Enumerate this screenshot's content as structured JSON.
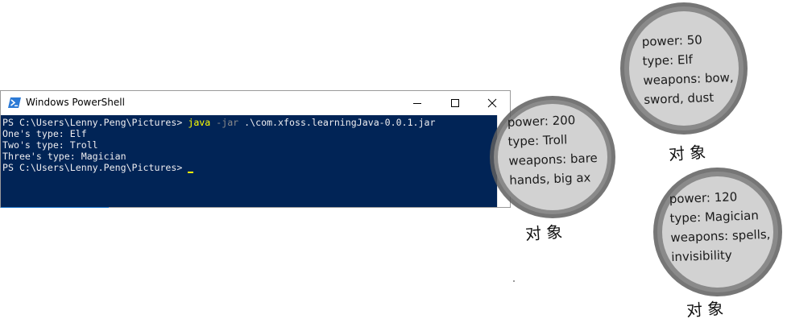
{
  "window": {
    "title": "Windows PowerShell",
    "buttons": {
      "minimize": "minimize",
      "maximize": "maximize",
      "close": "close"
    }
  },
  "console": {
    "prompt": "PS C:\\Users\\Lenny.Peng\\Pictures> ",
    "command_name": "java",
    "command_flag": " -jar",
    "command_arg": " .\\com.xfoss.learningJava-0.0.1.jar",
    "output": [
      "One's type: Elf",
      "Two's type: Troll",
      "Three's type: Magician"
    ],
    "prompt2": "PS C:\\Users\\Lenny.Peng\\Pictures> "
  },
  "objects": {
    "troll": {
      "lines": [
        "power: 200",
        "type: Troll",
        "weapons: bare",
        "hands, big ax"
      ],
      "caption": "对象"
    },
    "elf": {
      "lines": [
        "power: 50",
        "type: Elf",
        "weapons: bow,",
        "sword, dust"
      ],
      "caption": "对象"
    },
    "magician": {
      "lines": [
        "power: 120",
        "type: Magician",
        "weapons: spells,",
        "invisibility"
      ],
      "caption": "对象"
    }
  },
  "colors": {
    "console_bg": "#012456",
    "console_fg": "#eeedf0",
    "command_yellow": "#ffff00",
    "bubble_fill": "#d4d4d4",
    "bubble_rim": "#6e6e6e"
  }
}
